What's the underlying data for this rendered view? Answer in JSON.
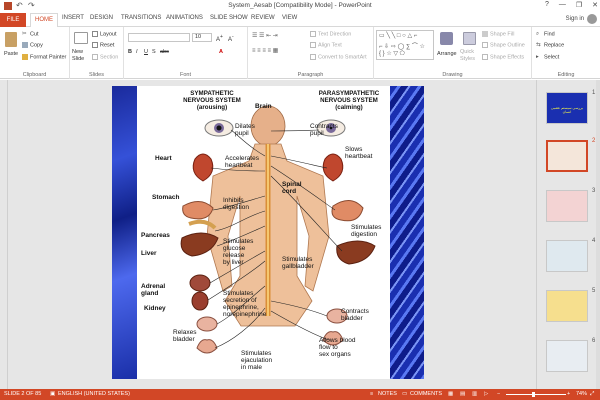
{
  "window": {
    "title": "System_Aesab [Compatibility Mode] - PowerPoint",
    "controls": [
      "?",
      "—",
      "❐",
      "✕"
    ]
  },
  "tabs": [
    "FILE",
    "HOME",
    "INSERT",
    "DESIGN",
    "TRANSITIONS",
    "ANIMATIONS",
    "SLIDE SHOW",
    "REVIEW",
    "VIEW"
  ],
  "account": {
    "signin": "Sign in"
  },
  "ribbon": {
    "clipboard": {
      "label": "Clipboard",
      "paste": "Paste",
      "cut": "Cut",
      "copy": "Copy",
      "format_painter": "Format Painter"
    },
    "slides": {
      "label": "Slides",
      "new_slide": "New Slide",
      "layout": "Layout",
      "reset": "Reset",
      "section": "Section"
    },
    "font": {
      "label": "Font",
      "size": "10"
    },
    "paragraph": {
      "label": "Paragraph",
      "text_direction": "Text Direction",
      "align_text": "Align Text",
      "smartart": "Convert to SmartArt"
    },
    "drawing": {
      "label": "Drawing",
      "arrange": "Arrange",
      "quick_styles": "Quick Styles",
      "shape_fill": "Shape Fill",
      "shape_outline": "Shape Outline",
      "shape_effects": "Shape Effects"
    },
    "editing": {
      "label": "Editing",
      "find": "Find",
      "replace": "Replace",
      "select": "Select"
    }
  },
  "figure": {
    "sympathetic_header": [
      "SYMPATHETIC",
      "NERVOUS SYSTEM",
      "(arousing)"
    ],
    "parasympathetic_header": [
      "PARASYMPATHETIC",
      "NERVOUS SYSTEM",
      "(calming)"
    ],
    "brain": "Brain",
    "spinal_cord": [
      "Spinal",
      "cord"
    ],
    "organs": {
      "heart": "Heart",
      "stomach": "Stomach",
      "pancreas": "Pancreas",
      "liver": "Liver",
      "adrenal": [
        "Adrenal",
        "gland"
      ],
      "kidney": "Kidney"
    },
    "sympathetic_effects": {
      "dilates": [
        "Dilates",
        "pupil"
      ],
      "accelerates": [
        "Accelerates",
        "heartbeat"
      ],
      "inhibits": [
        "Inhibits",
        "digestion"
      ],
      "glucose": [
        "Stimulates",
        "glucose",
        "release",
        "by liver"
      ],
      "secretion": [
        "Stimulates",
        "secretion of",
        "epinephrine,",
        "norepinephrine"
      ],
      "relax": [
        "Relaxes",
        "bladder"
      ],
      "ejaculation": [
        "Stimulates",
        "ejaculation",
        "in male"
      ]
    },
    "parasympathetic_effects": {
      "contracts_pupil": [
        "Contracts",
        "pupil"
      ],
      "slows": [
        "Slows",
        "heartbeat"
      ],
      "digestion": [
        "Stimulates",
        "digestion"
      ],
      "gallbladder": [
        "Stimulates",
        "gallbladder"
      ],
      "contracts_bladder": [
        "Contracts",
        "bladder"
      ],
      "blood": [
        "Allows blood",
        "flow to",
        "sex organs"
      ]
    }
  },
  "thumbnails": [
    "1",
    "2",
    "3",
    "4",
    "5",
    "6"
  ],
  "thumb1_text": "بررسی سیستم عصبی انسان",
  "status": {
    "slide": "SLIDE 2 OF 85",
    "language": "ENGLISH (UNITED STATES)",
    "notes": "NOTES",
    "comments": "COMMENTS",
    "zoom": "74%"
  },
  "colors": {
    "accent": "#d24726",
    "slide_blue": "#1a2fb0"
  }
}
